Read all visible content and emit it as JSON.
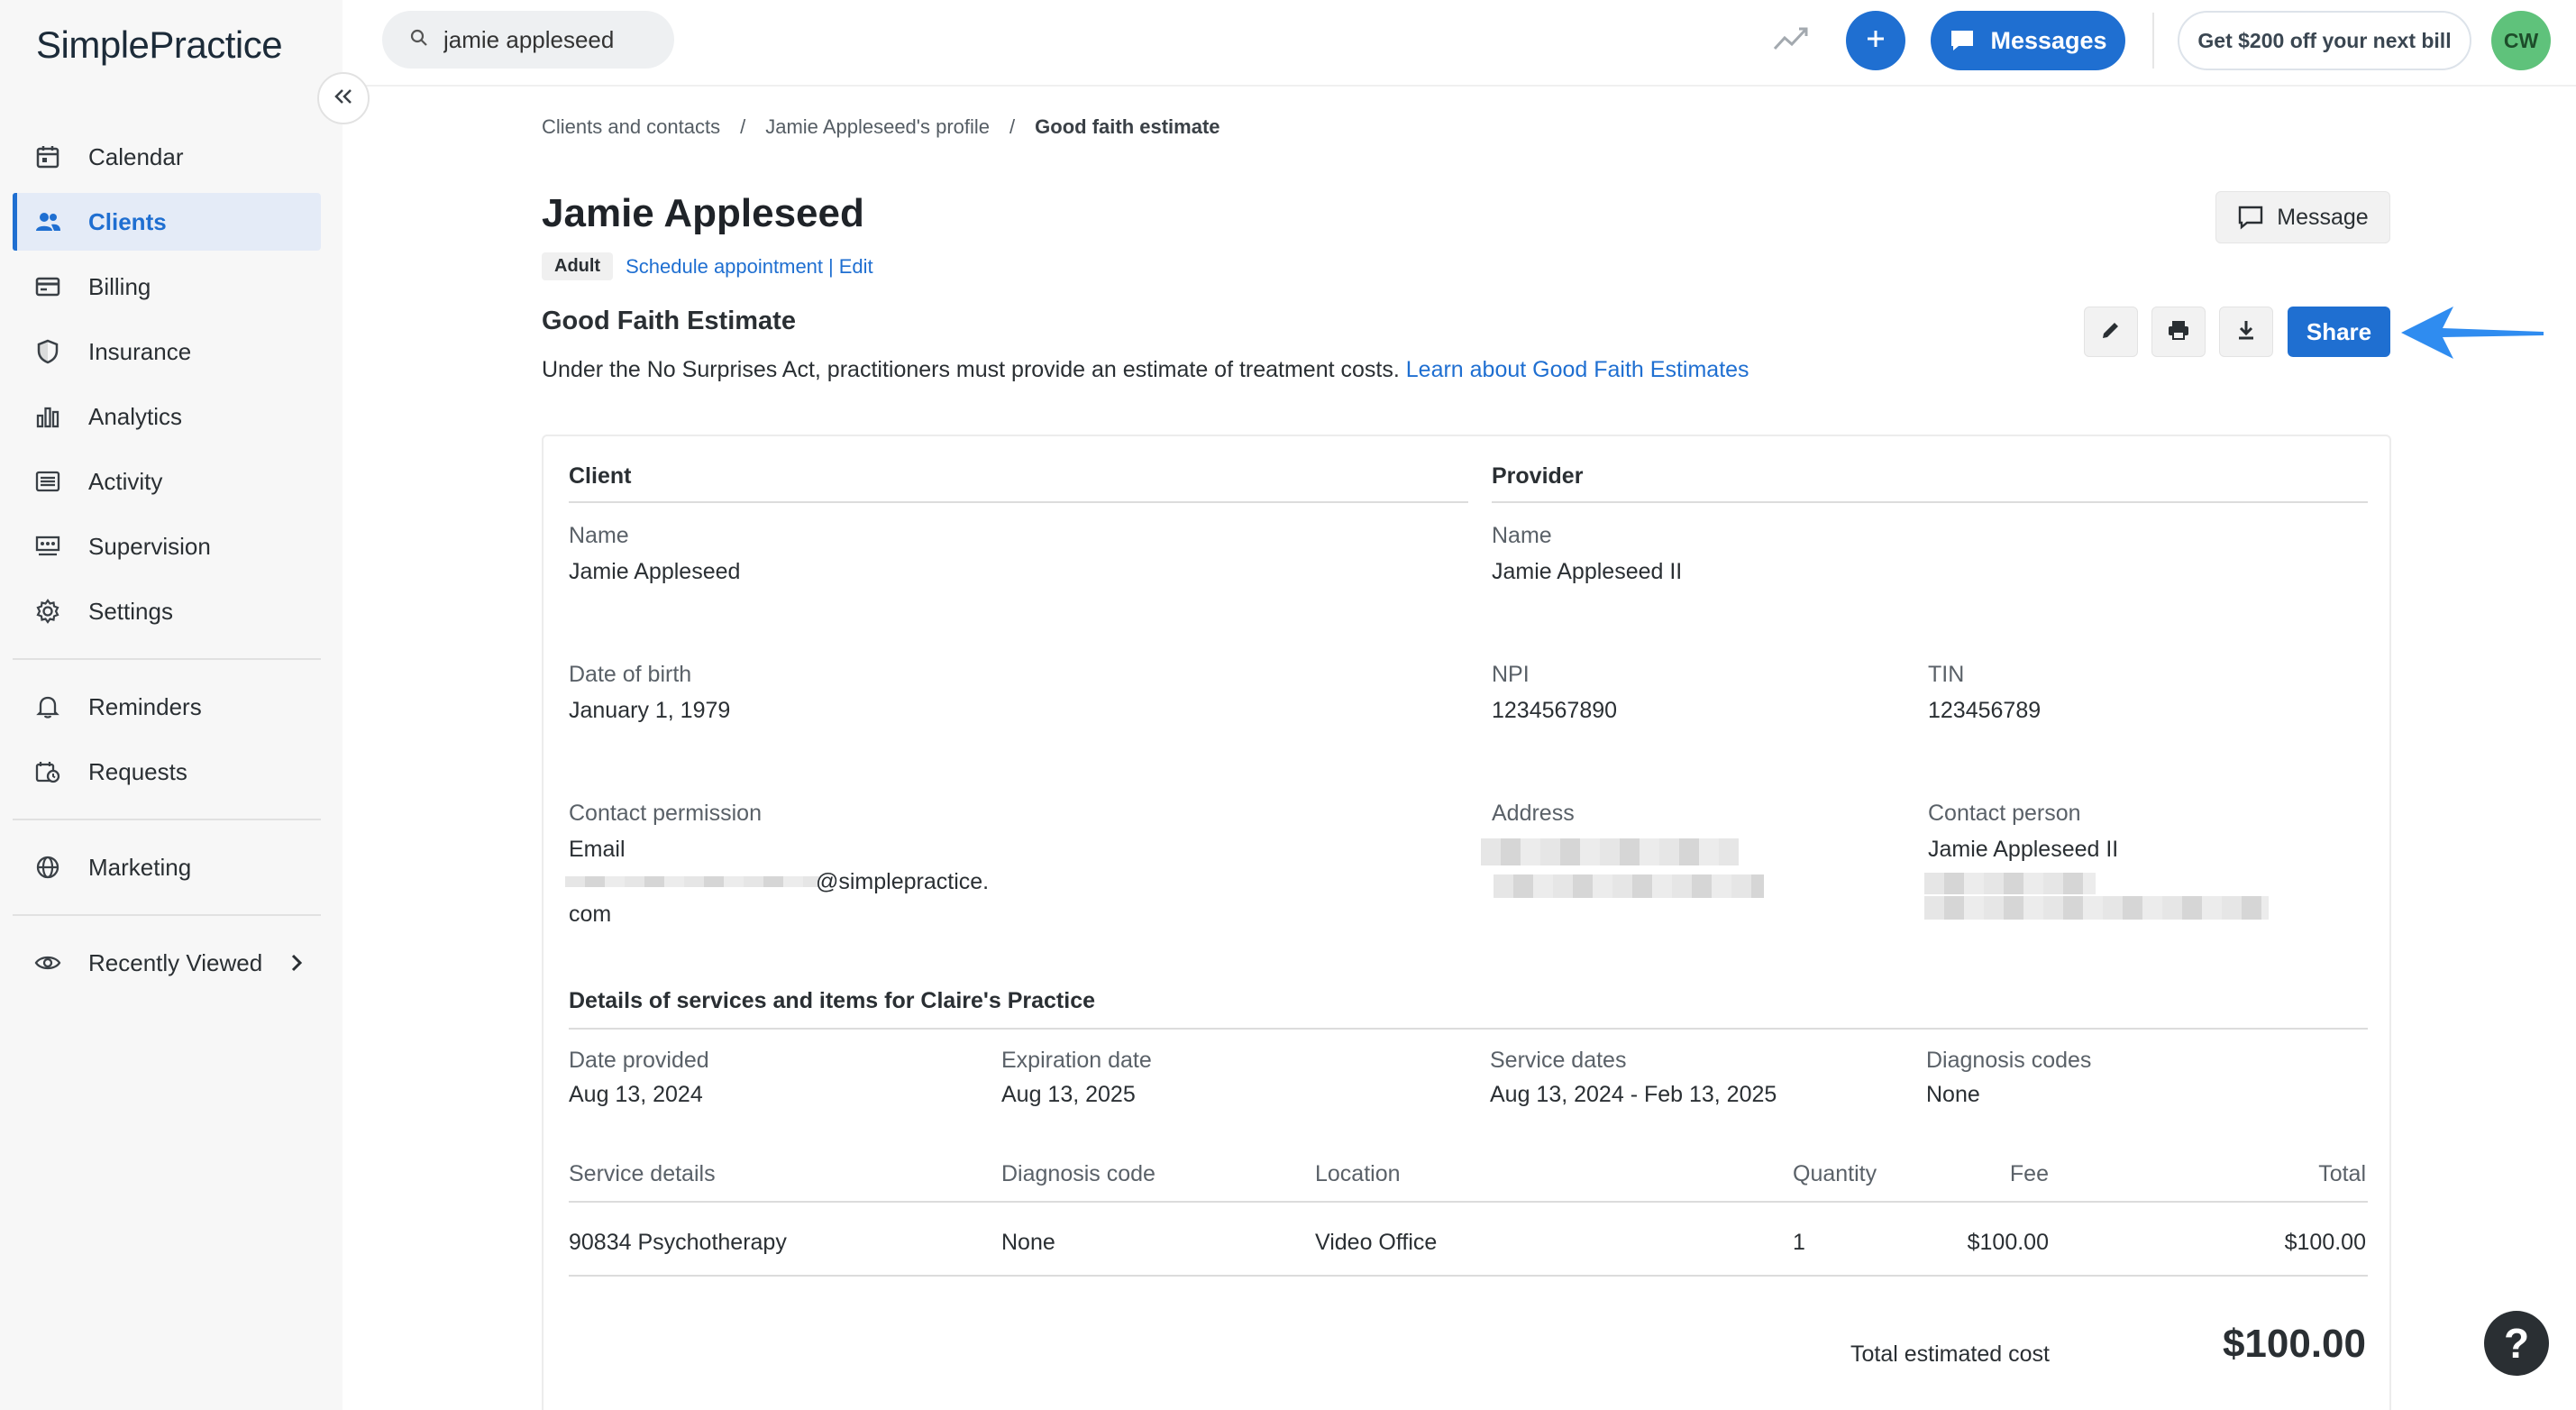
{
  "brand": {
    "logo_text": "SimplePractice"
  },
  "sidebar": {
    "items": [
      {
        "label": "Calendar",
        "icon": "calendar-icon",
        "active": false
      },
      {
        "label": "Clients",
        "icon": "clients-icon",
        "active": true
      },
      {
        "label": "Billing",
        "icon": "billing-icon",
        "active": false
      },
      {
        "label": "Insurance",
        "icon": "shield-icon",
        "active": false
      },
      {
        "label": "Analytics",
        "icon": "analytics-icon",
        "active": false
      },
      {
        "label": "Activity",
        "icon": "activity-icon",
        "active": false
      },
      {
        "label": "Supervision",
        "icon": "supervision-icon",
        "active": false
      },
      {
        "label": "Settings",
        "icon": "gear-icon",
        "active": false
      }
    ],
    "secondary": [
      {
        "label": "Reminders",
        "icon": "bell-icon"
      },
      {
        "label": "Requests",
        "icon": "requests-icon"
      }
    ],
    "tertiary": [
      {
        "label": "Marketing",
        "icon": "globe-icon"
      }
    ],
    "recently_viewed": {
      "label": "Recently Viewed",
      "icon": "eye-icon"
    }
  },
  "topbar": {
    "search_value": "jamie appleseed",
    "messages_label": "Messages",
    "promo_label": "Get $200 off your next bill",
    "avatar_initials": "CW"
  },
  "breadcrumb": {
    "items": [
      "Clients and contacts",
      "/",
      "Jamie Appleseed's profile",
      "/"
    ],
    "current": "Good faith estimate"
  },
  "client": {
    "name": "Jamie Appleseed",
    "badge": "Adult",
    "schedule_link": "Schedule appointment",
    "separator": "|",
    "edit_link": "Edit"
  },
  "header_actions": {
    "message_label": "Message",
    "share_label": "Share"
  },
  "estimate": {
    "title": "Good Faith Estimate",
    "description": "Under the No Surprises Act, practitioners must provide an estimate of treatment costs.",
    "learn_link": "Learn about Good Faith Estimates"
  },
  "card": {
    "client_heading": "Client",
    "provider_heading": "Provider",
    "client_fields": {
      "name_label": "Name",
      "name_value": "Jamie Appleseed",
      "dob_label": "Date of birth",
      "dob_value": "January 1, 1979",
      "contact_label": "Contact permission",
      "contact_method": "Email",
      "email_domain": "@simplepractice.",
      "email_tld": "com"
    },
    "provider_fields": {
      "name_label": "Name",
      "name_value": "Jamie Appleseed II",
      "npi_label": "NPI",
      "npi_value": "1234567890",
      "tin_label": "TIN",
      "tin_value": "123456789",
      "address_label": "Address",
      "contact_person_label": "Contact person",
      "contact_person_value": "Jamie Appleseed II"
    },
    "details_heading": "Details of services and items for Claire's Practice",
    "meta": {
      "date_provided_label": "Date provided",
      "date_provided_value": "Aug 13, 2024",
      "expiration_label": "Expiration date",
      "expiration_value": "Aug 13, 2025",
      "service_dates_label": "Service dates",
      "service_dates_value": "Aug 13, 2024 - Feb 13, 2025",
      "diagnosis_codes_label": "Diagnosis codes",
      "diagnosis_codes_value": "None"
    },
    "table": {
      "headers": [
        "Service details",
        "Diagnosis code",
        "Location",
        "Quantity",
        "Fee",
        "Total"
      ],
      "rows": [
        [
          "90834 Psychotherapy",
          "None",
          "Video Office",
          "1",
          "$100.00",
          "$100.00"
        ]
      ]
    },
    "total_label": "Total estimated cost",
    "total_value": "$100.00"
  },
  "help": {
    "label": "?"
  },
  "colors": {
    "accent": "#1f6fd1",
    "avatar": "#5fc27b",
    "arrow": "#2f8cf0"
  }
}
